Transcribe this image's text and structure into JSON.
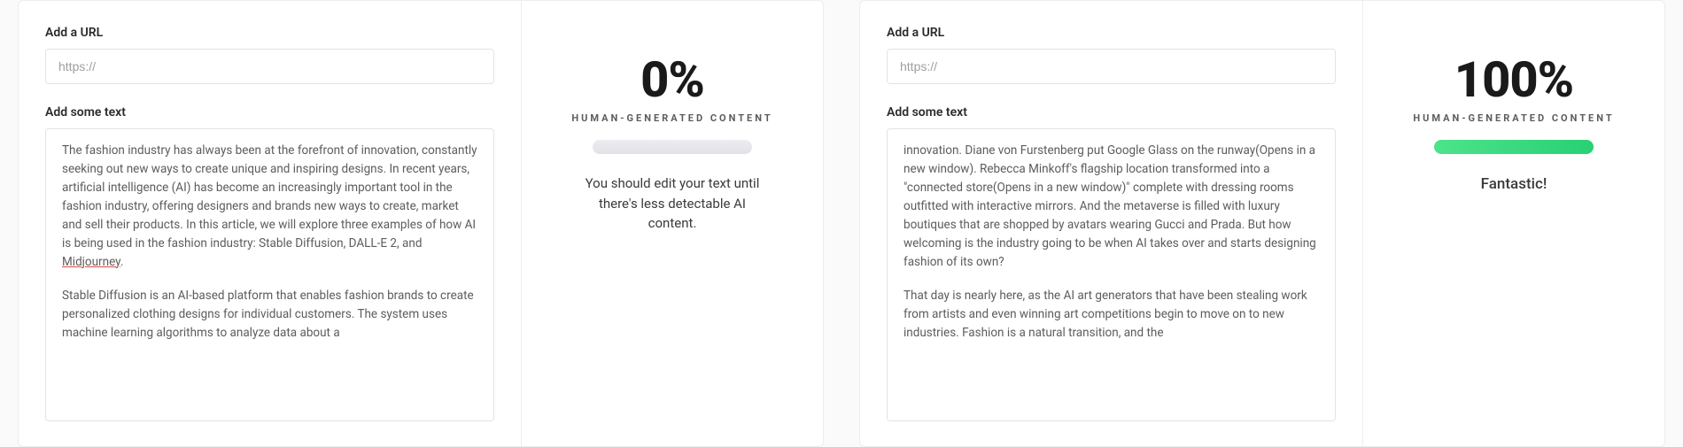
{
  "left": {
    "url_label": "Add a URL",
    "url_placeholder": "https://",
    "text_label": "Add some text",
    "text_p1_a": "The fashion industry has always been at the forefront of innovation, constantly seeking out new ways to create unique and inspiring designs. In recent years, artificial intelligence (AI) has become an increasingly important tool in the fashion industry, offering designers and brands new ways to create, market and sell their products. In this article, we will explore three examples of how AI is being used in the fashion industry: Stable Diffusion, DALL-E 2, and ",
    "text_p1_link": "Midjourney",
    "text_p1_b": ".",
    "text_p2": "Stable Diffusion is an AI-based platform that enables fashion brands to create personalized clothing designs for individual customers. The system uses machine learning algorithms to analyze data about a",
    "percent": "0%",
    "percent_label": "HUMAN-GENERATED CONTENT",
    "message": "You should edit your text until there's less detectable AI content."
  },
  "right": {
    "url_label": "Add a URL",
    "url_placeholder": "https://",
    "text_label": "Add some text",
    "text_p1": "innovation. Diane von Furstenberg put Google Glass on the runway(Opens in a new window). Rebecca Minkoff's flagship location transformed into a \"connected store(Opens in a new window)\" complete with dressing rooms outfitted with interactive mirrors. And the metaverse is filled with luxury boutiques that are shopped by avatars wearing Gucci and Prada. But how welcoming is the industry going to be when AI takes over and starts designing fashion of its own?",
    "text_p2": "That day is nearly here, as the AI art generators that have been stealing work from artists and even winning art competitions begin to move on to new industries. Fashion is a natural transition, and the",
    "percent": "100%",
    "percent_label": "HUMAN-GENERATED CONTENT",
    "message": "Fantastic!"
  }
}
